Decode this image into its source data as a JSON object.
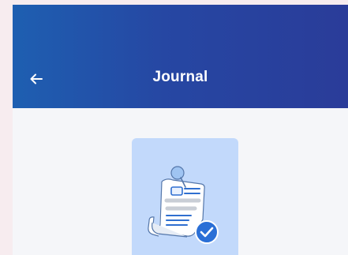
{
  "app_bar": {
    "title": "Journal",
    "back_icon": "arrow-left-icon",
    "gradient_colors": [
      "#1e5fb1",
      "#2a3c99"
    ]
  },
  "illustration": {
    "icon": "journal-document-check-icon",
    "card_color": "#c2d9fb",
    "check_color": "#2a6fd6"
  }
}
